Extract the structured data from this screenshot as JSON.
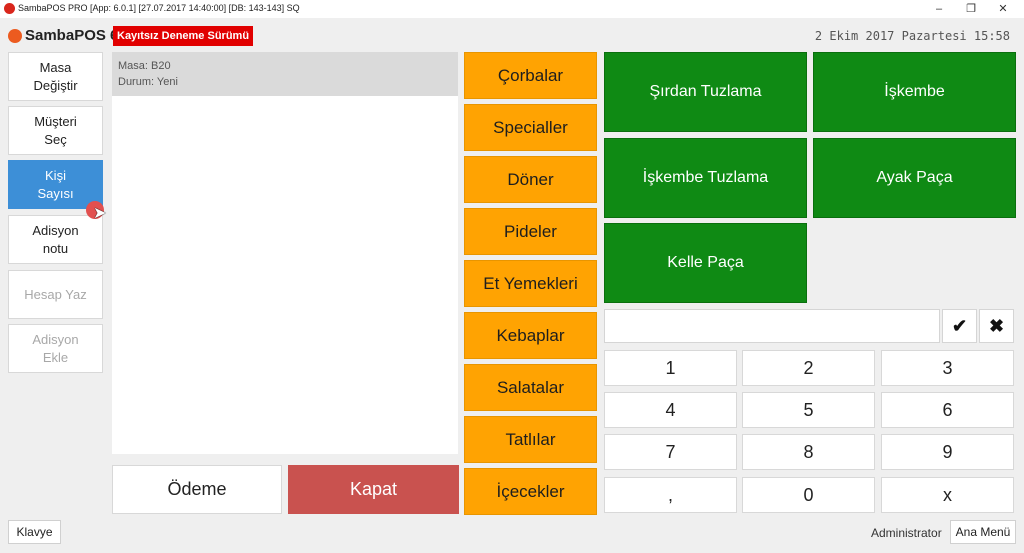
{
  "window": {
    "title": "SambaPOS PRO [App: 6.0.1] [27.07.2017 14:40:00] [DB: 143-143] SQ",
    "minimize_icon": "minimize-icon",
    "maximize_icon": "restore-icon",
    "close_icon": "close-icon"
  },
  "header": {
    "logo_text": "SambaPOS 6",
    "trial_badge": "Kayıtsız Deneme Sürümü",
    "date": "2 Ekim 2017 Pazartesi 15:58"
  },
  "left_buttons": [
    {
      "label": "Masa\nDeğiştir",
      "state": "normal"
    },
    {
      "label": "Müşteri\nSeç",
      "state": "normal"
    },
    {
      "label": "Kişi\nSayısı",
      "state": "active"
    },
    {
      "label": "Adisyon\nnotu",
      "state": "normal"
    },
    {
      "label": "Hesap Yaz",
      "state": "disabled"
    },
    {
      "label": "Adisyon\nEkle",
      "state": "disabled"
    }
  ],
  "ticket": {
    "table": "Masa: B20",
    "status": "Durum: Yeni"
  },
  "actions": {
    "payment": "Ödeme",
    "close": "Kapat"
  },
  "categories": [
    "Çorbalar",
    "Specialler",
    "Döner",
    "Pideler",
    "Et Yemekleri",
    "Kebaplar",
    "Salatalar",
    "Tatlılar",
    "İçecekler"
  ],
  "products": [
    "Şırdan Tuzlama",
    "İşkembe",
    "İşkembe Tuzlama",
    "Ayak Paça",
    "Kelle Paça"
  ],
  "numpad": {
    "input_value": "",
    "confirm_icon": "checkmark-icon",
    "clear_icon": "x-icon",
    "keys": [
      "1",
      "2",
      "3",
      "4",
      "5",
      "6",
      "7",
      "8",
      "9",
      ",",
      "0",
      "x"
    ]
  },
  "footer": {
    "keyboard": "Klavye",
    "user": "Administrator",
    "main_menu": "Ana Menü"
  },
  "colors": {
    "category": "#ffa302",
    "product": "#0f8a14",
    "active_button": "#3d8fd7",
    "close_button": "#c9524f",
    "trial_badge": "#e10000"
  }
}
